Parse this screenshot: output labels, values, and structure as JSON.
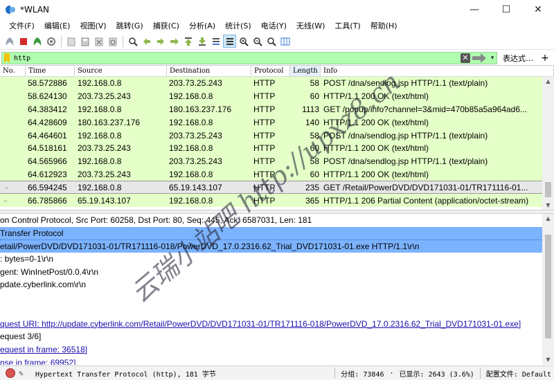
{
  "window": {
    "title": "*WLAN",
    "minimize": "—",
    "maximize": "☐",
    "close": "✕"
  },
  "menu": [
    "文件(F)",
    "编辑(E)",
    "视图(V)",
    "跳转(G)",
    "捕获(C)",
    "分析(A)",
    "统计(S)",
    "电话(Y)",
    "无线(W)",
    "工具(T)",
    "帮助(H)"
  ],
  "filter": {
    "value": "http",
    "expression_label": "表达式…",
    "add_label": "+"
  },
  "columns": [
    "No.",
    "Time",
    "Source",
    "Destination",
    "Protocol",
    "Length",
    "Info"
  ],
  "packets": [
    {
      "time": "58.572886",
      "src": "192.168.0.8",
      "dst": "203.73.25.243",
      "proto": "HTTP",
      "len": "58",
      "info": "POST /dna/sendlog.jsp HTTP/1.1  (text/plain)"
    },
    {
      "time": "58.624130",
      "src": "203.73.25.243",
      "dst": "192.168.0.8",
      "proto": "HTTP",
      "len": "60",
      "info": "HTTP/1.1 200 OK  (text/html)"
    },
    {
      "time": "64.383412",
      "src": "192.168.0.8",
      "dst": "180.163.237.176",
      "proto": "HTTP",
      "len": "1113",
      "info": "GET /popup/info?channel=3&mid=470b85a5a964ad6..."
    },
    {
      "time": "64.428609",
      "src": "180.163.237.176",
      "dst": "192.168.0.8",
      "proto": "HTTP",
      "len": "140",
      "info": "HTTP/1.1 200 OK  (text/html)"
    },
    {
      "time": "64.464601",
      "src": "192.168.0.8",
      "dst": "203.73.25.243",
      "proto": "HTTP",
      "len": "58",
      "info": "POST /dna/sendlog.jsp HTTP/1.1  (text/plain)"
    },
    {
      "time": "64.518161",
      "src": "203.73.25.243",
      "dst": "192.168.0.8",
      "proto": "HTTP",
      "len": "60",
      "info": "HTTP/1.1 200 OK  (text/html)"
    },
    {
      "time": "64.565966",
      "src": "192.168.0.8",
      "dst": "203.73.25.243",
      "proto": "HTTP",
      "len": "58",
      "info": "POST /dna/sendlog.jsp HTTP/1.1  (text/plain)"
    },
    {
      "time": "64.612923",
      "src": "203.73.25.243",
      "dst": "192.168.0.8",
      "proto": "HTTP",
      "len": "60",
      "info": "HTTP/1.1 200 OK  (text/html)"
    },
    {
      "time": "66.594245",
      "src": "192.168.0.8",
      "dst": "65.19.143.107",
      "proto": "HTTP",
      "len": "235",
      "info": "GET /Retail/PowerDVD/DVD171031-01/TR171116-01...",
      "selected": true,
      "marker": "→"
    },
    {
      "time": "66.785866",
      "src": "65.19.143.107",
      "dst": "192.168.0.8",
      "proto": "HTTP",
      "len": "365",
      "info": "HTTP/1.1 206 Partial Content  (application/octet-stream)",
      "marker": "←"
    }
  ],
  "details": [
    {
      "text": "on Control Protocol, Src Port: 60258, Dst Port: 80, Seq: 445, Ack: 6587031, Len: 181",
      "style": ""
    },
    {
      "text": " Transfer Protocol",
      "style": "hl1"
    },
    {
      "text": "etail/PowerDVD/DVD171031-01/TR171116-018/PowerDVD_17.0.2316.62_Trial_DVD171031-01.exe HTTP/1.1\\r\\n",
      "style": "hl2"
    },
    {
      "text": ": bytes=0-1\\r\\n",
      "style": ""
    },
    {
      "text": "gent: WinInetPost/0.0.4\\r\\n",
      "style": ""
    },
    {
      "text": "pdate.cyberlink.com\\r\\n",
      "style": ""
    },
    {
      "text": "",
      "style": ""
    },
    {
      "text": "",
      "style": ""
    },
    {
      "text": "quest URI: http://update.cyberlink.com/Retail/PowerDVD/DVD171031-01/TR171116-018/PowerDVD_17.0.2316.62_Trial_DVD171031-01.exe]",
      "style": "link"
    },
    {
      "text": "equest 3/6]",
      "style": ""
    },
    {
      "text": "equest in frame: 36518]",
      "style": "link"
    },
    {
      "text": "nse in frame: 69952]",
      "style": "link"
    }
  ],
  "status": {
    "message": "Hypertext Transfer Protocol (http), 181 字节",
    "packets": "分组: 73846",
    "displayed": "已显示: 2643 (3.6%)",
    "profile": "配置文件: Default"
  },
  "watermark": "云瑞小站吧 http://upxz8.cn"
}
